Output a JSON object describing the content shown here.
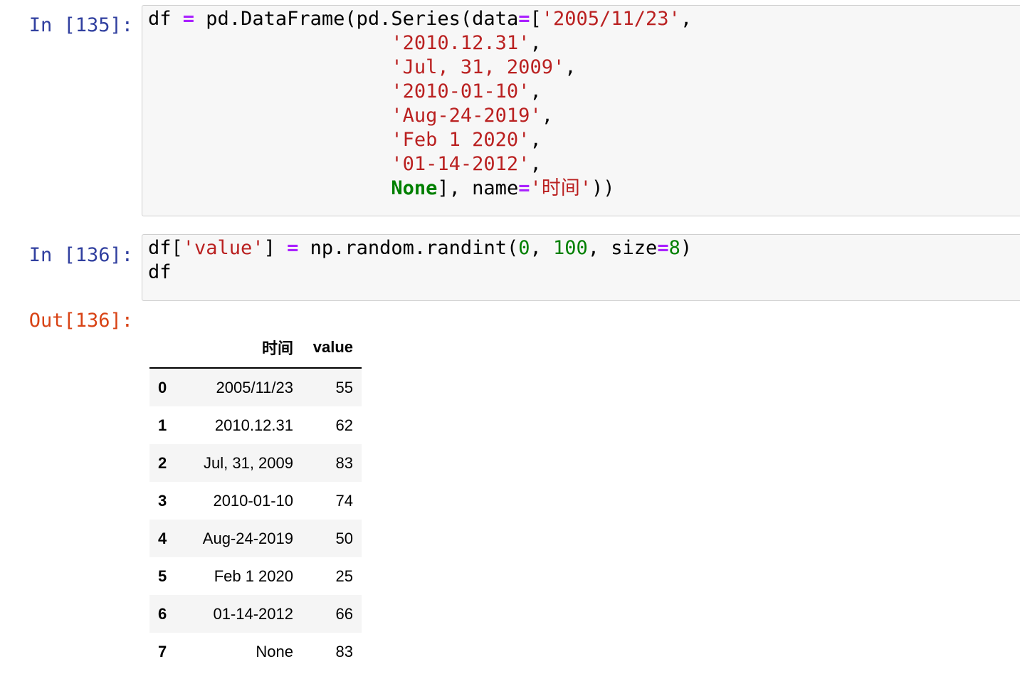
{
  "cells": [
    {
      "prompt": "In [135]:",
      "code": [
        [
          {
            "t": "df "
          },
          {
            "t": "=",
            "c": "op"
          },
          {
            "t": " pd.DataFrame(pd.Series(data"
          },
          {
            "t": "=",
            "c": "op"
          },
          {
            "t": "["
          },
          {
            "t": "'2005/11/23'",
            "c": "str"
          },
          {
            "t": ","
          }
        ],
        [
          {
            "t": "                     "
          },
          {
            "t": "'2010.12.31'",
            "c": "str"
          },
          {
            "t": ","
          }
        ],
        [
          {
            "t": "                     "
          },
          {
            "t": "'Jul, 31, 2009'",
            "c": "str"
          },
          {
            "t": ","
          }
        ],
        [
          {
            "t": "                     "
          },
          {
            "t": "'2010-01-10'",
            "c": "str"
          },
          {
            "t": ","
          }
        ],
        [
          {
            "t": "                     "
          },
          {
            "t": "'Aug-24-2019'",
            "c": "str"
          },
          {
            "t": ","
          }
        ],
        [
          {
            "t": "                     "
          },
          {
            "t": "'Feb 1 2020'",
            "c": "str"
          },
          {
            "t": ","
          }
        ],
        [
          {
            "t": "                     "
          },
          {
            "t": "'01-14-2012'",
            "c": "str"
          },
          {
            "t": ","
          }
        ],
        [
          {
            "t": "                     "
          },
          {
            "t": "None",
            "c": "kw"
          },
          {
            "t": "], name"
          },
          {
            "t": "=",
            "c": "op"
          },
          {
            "t": "'时间'",
            "c": "str"
          },
          {
            "t": "))"
          }
        ]
      ]
    },
    {
      "prompt": "In [136]:",
      "code": [
        [
          {
            "t": "df["
          },
          {
            "t": "'value'",
            "c": "str"
          },
          {
            "t": "] "
          },
          {
            "t": "=",
            "c": "op"
          },
          {
            "t": " np.random.randint("
          },
          {
            "t": "0",
            "c": "num"
          },
          {
            "t": ", "
          },
          {
            "t": "100",
            "c": "num"
          },
          {
            "t": ", size"
          },
          {
            "t": "=",
            "c": "op"
          },
          {
            "t": "8",
            "c": "num"
          },
          {
            "t": ")"
          }
        ],
        [
          {
            "t": "df"
          }
        ]
      ]
    }
  ],
  "output": {
    "prompt": "Out[136]:",
    "columns": [
      "",
      "时间",
      "value"
    ],
    "rows": [
      [
        "0",
        "2005/11/23",
        "55"
      ],
      [
        "1",
        "2010.12.31",
        "62"
      ],
      [
        "2",
        "Jul, 31, 2009",
        "83"
      ],
      [
        "3",
        "2010-01-10",
        "74"
      ],
      [
        "4",
        "Aug-24-2019",
        "50"
      ],
      [
        "5",
        "Feb 1 2020",
        "25"
      ],
      [
        "6",
        "01-14-2012",
        "66"
      ],
      [
        "7",
        "None",
        "83"
      ]
    ]
  },
  "colors": {
    "in_prompt": "#303f9f",
    "out_prompt": "#d84315",
    "string": "#ba2121",
    "number": "#008000",
    "keyword": "#008000",
    "operator": "#aa22ff",
    "cell_background": "#f7f7f7",
    "cell_border": "#cfcfcf"
  }
}
